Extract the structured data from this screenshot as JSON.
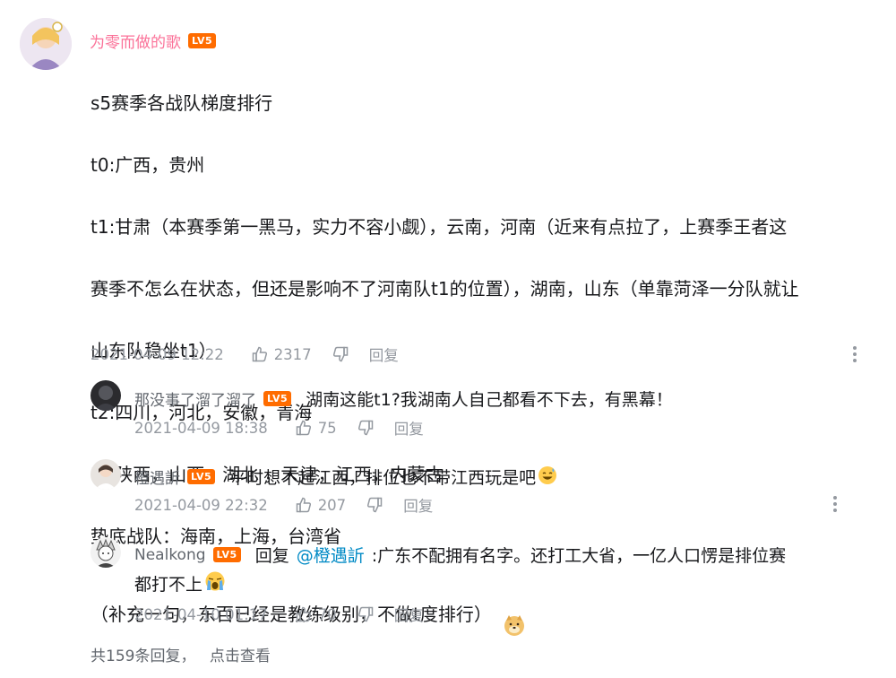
{
  "main_comment": {
    "username": "为零而做的歌",
    "level": "LV5",
    "lines": [
      "s5赛季各战队梯度排行",
      "t0:广西，贵州",
      "t1:甘肃（本赛季第一黑马，实力不容小觑），云南，河南（近来有点拉了，上赛季王者这",
      "赛季不怎么在状态，但还是影响不了河南队t1的位置），湖南，山东（单靠菏泽一分队就让",
      "山东队稳坐t1）",
      "t2:四川，河北，安徽，青海",
      "t3:陕西，山西，湖北 ，天津，江西，内蒙古",
      "垫底战队：海南，上海，台湾省",
      "（补充一句，东百已经是教练级别，不做t度排行）"
    ],
    "timestamp": "2021-04-09 12:22",
    "likes": "2317",
    "reply_label": "回复"
  },
  "replies": [
    {
      "username": "那没事了溜了溜了",
      "level": "LV5",
      "text": "湖南这能t1?我湖南人自己都看不下去，有黑幕！",
      "timestamp": "2021-04-09 18:38",
      "likes": "75",
      "reply_label": "回复"
    },
    {
      "username": "橙遇訢",
      "level": "LV5",
      "text": "平时想不起江西，排位也不带江西玩是吧",
      "timestamp": "2021-04-09 22:32",
      "likes": "207",
      "reply_label": "回复"
    },
    {
      "username": "Nealkong",
      "level": "LV5",
      "reply_prefix": "回复",
      "mention": "@橙遇訢",
      "text_line1": " :广东不配拥有名字。还打工大省，一亿人口愣是排位赛",
      "text_line2": "都打不上",
      "timestamp": "2021-04-10 01:17",
      "likes": "70",
      "reply_label": "回复"
    }
  ],
  "footer": {
    "count_text": "共159条回复，",
    "view_link": "点击查看"
  },
  "colors": {
    "username_accent": "#fb7299",
    "level_badge": "#ff6c00",
    "mention": "#008ac5",
    "meta_gray": "#9499a0"
  }
}
